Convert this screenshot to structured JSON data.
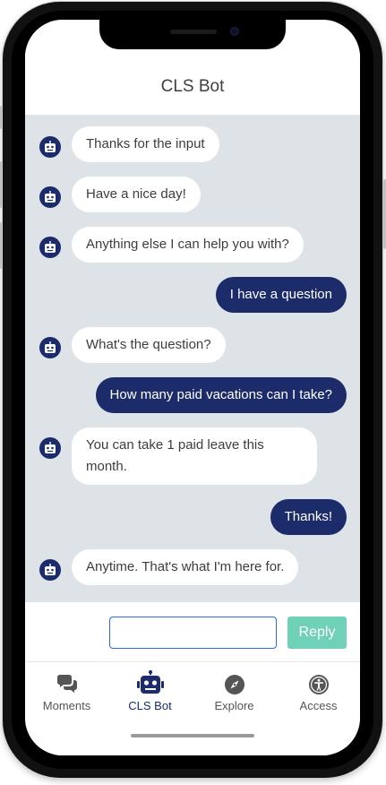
{
  "header": {
    "title": "CLS Bot"
  },
  "messages": [
    {
      "from": "bot",
      "text": "Thanks for the input"
    },
    {
      "from": "bot",
      "text": "Have a nice day!"
    },
    {
      "from": "bot",
      "text": "Anything else I can help you with?"
    },
    {
      "from": "user",
      "text": "I have a question"
    },
    {
      "from": "bot",
      "text": "What's the question?"
    },
    {
      "from": "user",
      "text": "How many paid vacations can I take?"
    },
    {
      "from": "bot",
      "text": "You can take 1 paid leave this month."
    },
    {
      "from": "user",
      "text": "Thanks!"
    },
    {
      "from": "bot",
      "text": "Anytime. That's what I'm here for."
    }
  ],
  "composer": {
    "value": "",
    "reply_label": "Reply"
  },
  "tabs": [
    {
      "label": "Moments",
      "icon": "chat-bubbles-icon",
      "active": false
    },
    {
      "label": "CLS Bot",
      "icon": "robot-icon",
      "active": true
    },
    {
      "label": "Explore",
      "icon": "compass-icon",
      "active": false
    },
    {
      "label": "Access",
      "icon": "accessibility-icon",
      "active": false
    }
  ],
  "colors": {
    "accent": "#1c2c6b",
    "chat_bg": "#dde3e7",
    "reply_button": "#6fd1b8"
  }
}
